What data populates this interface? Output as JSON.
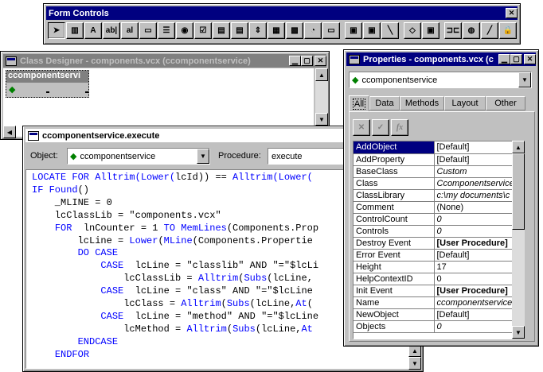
{
  "form_controls": {
    "title": "Form Controls",
    "tools": [
      "select-objects",
      "view-classes",
      "label",
      "text-box",
      "edit-box",
      "command-button",
      "command-group",
      "option-group",
      "check-box",
      "combo-box",
      "list-box",
      "spinner",
      "grid",
      "image",
      "timer",
      "page-frame",
      "ole-container",
      "ole-bound",
      "line",
      "shape",
      "container",
      "separator",
      "hyperlink",
      "builder-lock",
      "button-lock"
    ],
    "tool_glyphs": [
      "➤",
      "▥",
      "A",
      "ab|",
      "al",
      "▭",
      "☰",
      "◉",
      "☑",
      "▤",
      "▤",
      "⇕",
      "▦",
      "▩",
      "◔",
      "▭",
      "▣",
      "▣",
      "╲",
      "◇",
      "▣",
      "⊐⊏",
      "◍",
      "╱",
      "🔒"
    ]
  },
  "class_designer": {
    "title": "Class Designer - components.vcx (ccomponentservice)",
    "object_title": "ccomponentservi"
  },
  "code_window": {
    "title": "ccomponentservice.execute",
    "object_label": "Object:",
    "object_value": "ccomponentservice",
    "procedure_label": "Procedure:",
    "procedure_value": "execute",
    "lines": [
      [
        [
          "kw",
          "LOCATE FOR Alltrim(Lower("
        ],
        [
          "",
          "lcId)) == "
        ],
        [
          "kw",
          "Alltrim(Lower("
        ]
      ],
      [
        [
          "kw",
          "IF Found"
        ],
        [
          "",
          "()"
        ]
      ],
      [
        [
          "",
          "    _MLINE = 0"
        ]
      ],
      [
        [
          "",
          "    lcClassLib = \"components.vcx\""
        ]
      ],
      [
        [
          "",
          "    "
        ],
        [
          "kw",
          "FOR"
        ],
        [
          "",
          "  lnCounter = 1 "
        ],
        [
          "kw",
          "TO MemLines"
        ],
        [
          "",
          "(Components.Prop"
        ]
      ],
      [
        [
          "",
          "        lcLine = "
        ],
        [
          "kw",
          "Lower"
        ],
        [
          "",
          "("
        ],
        [
          "kw",
          "MLine"
        ],
        [
          "",
          "(Components.Propertie"
        ]
      ],
      [
        [
          "",
          "        "
        ],
        [
          "kw",
          "DO CASE"
        ]
      ],
      [
        [
          "",
          "            "
        ],
        [
          "kw",
          "CASE"
        ],
        [
          "",
          "  lcLine = \"classlib\" AND \"=\"$lcLi"
        ]
      ],
      [
        [
          "",
          "                lcClassLib = "
        ],
        [
          "kw",
          "Alltrim"
        ],
        [
          "",
          "("
        ],
        [
          "kw",
          "Subs"
        ],
        [
          "",
          "(lcLine,"
        ]
      ],
      [
        [
          "",
          "            "
        ],
        [
          "kw",
          "CASE"
        ],
        [
          "",
          "  lcLine = \"class\" AND \"=\"$lcLine"
        ]
      ],
      [
        [
          "",
          "                lcClass = "
        ],
        [
          "kw",
          "Alltrim"
        ],
        [
          "",
          "("
        ],
        [
          "kw",
          "Subs"
        ],
        [
          "",
          "(lcLine,"
        ],
        [
          "kw",
          "At"
        ],
        [
          "",
          "("
        ]
      ],
      [
        [
          "",
          "            "
        ],
        [
          "kw",
          "CASE"
        ],
        [
          "",
          "  lcLine = \"method\" AND \"=\"$lcLine"
        ]
      ],
      [
        [
          "",
          "                lcMethod = "
        ],
        [
          "kw",
          "Alltrim"
        ],
        [
          "",
          "("
        ],
        [
          "kw",
          "Subs"
        ],
        [
          "",
          "(lcLine,"
        ],
        [
          "kw",
          "At"
        ]
      ],
      [
        [
          "",
          "        "
        ],
        [
          "kw",
          "ENDCASE"
        ]
      ],
      [
        [
          "",
          "    "
        ],
        [
          "kw",
          "ENDFOR"
        ]
      ]
    ]
  },
  "properties": {
    "title": "Properties - components.vcx (c",
    "object_value": "ccomponentservice",
    "tabs": [
      "All",
      "Data",
      "Methods",
      "Layout",
      "Other"
    ],
    "rows": [
      {
        "name": "AddObject",
        "value": "[Default]",
        "style": "sel"
      },
      {
        "name": "AddProperty",
        "value": "[Default]",
        "style": ""
      },
      {
        "name": "BaseClass",
        "value": "Custom",
        "style": "it"
      },
      {
        "name": "Class",
        "value": "Ccomponentservice",
        "style": "it"
      },
      {
        "name": "ClassLibrary",
        "value": "c:\\my documents\\c",
        "style": "it"
      },
      {
        "name": "Comment",
        "value": "(None)",
        "style": ""
      },
      {
        "name": "ControlCount",
        "value": "0",
        "style": "it"
      },
      {
        "name": "Controls",
        "value": "0",
        "style": "it"
      },
      {
        "name": "Destroy Event",
        "value": "[User Procedure]",
        "style": "bd"
      },
      {
        "name": "Error Event",
        "value": "[Default]",
        "style": ""
      },
      {
        "name": "Height",
        "value": "17",
        "style": ""
      },
      {
        "name": "HelpContextID",
        "value": "0",
        "style": ""
      },
      {
        "name": "Init Event",
        "value": "[User Procedure]",
        "style": "bd"
      },
      {
        "name": "Name",
        "value": "ccomponentservice",
        "style": "it"
      },
      {
        "name": "NewObject",
        "value": "[Default]",
        "style": ""
      },
      {
        "name": "Objects",
        "value": "0",
        "style": "it"
      }
    ]
  },
  "colors": {
    "titlebar_active": "#000080",
    "titlebar_inactive": "#808080",
    "face": "#c0c0c0",
    "keyword": "#0000ff"
  }
}
